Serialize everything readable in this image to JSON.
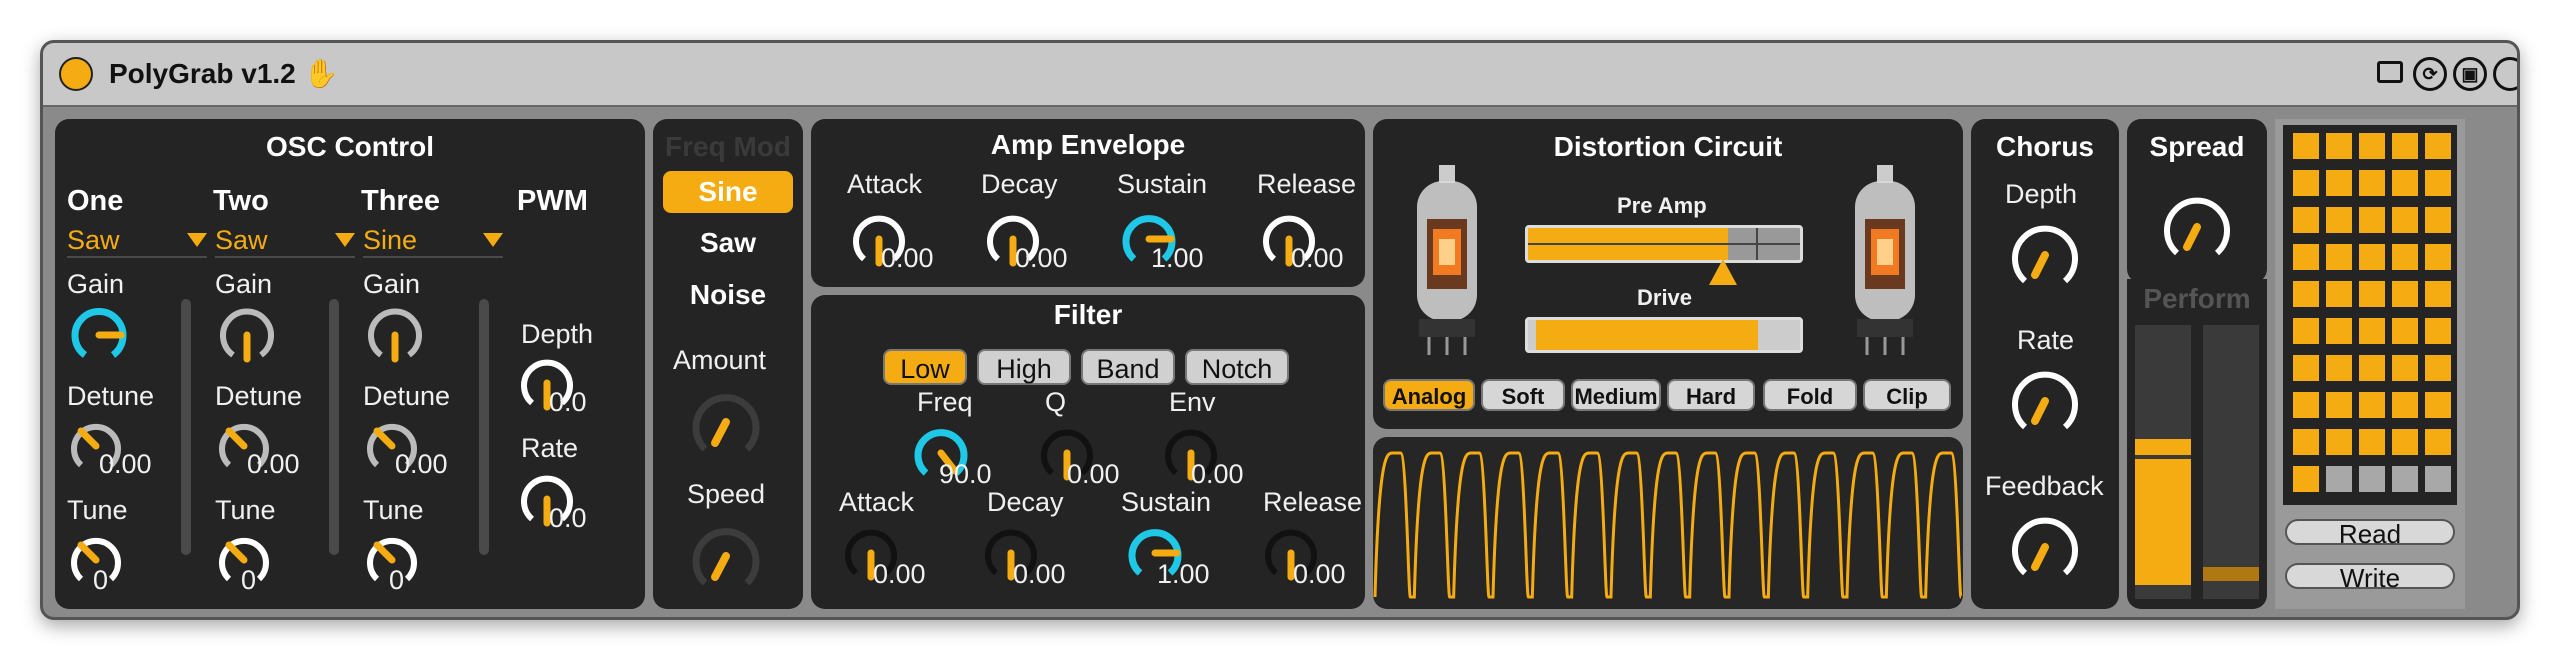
{
  "window": {
    "title": "PolyGrab v1.2"
  },
  "colors": {
    "accent": "#f5ac12",
    "cyan": "#1ec8e6",
    "panel": "#242424"
  },
  "osc": {
    "title": "OSC Control",
    "cols": [
      {
        "name": "One",
        "wave": "Saw",
        "gain": "Gain",
        "detune": "Detune",
        "detune_val": "0.00",
        "tune": "Tune",
        "tune_val": "0"
      },
      {
        "name": "Two",
        "wave": "Saw",
        "gain": "Gain",
        "detune": "Detune",
        "detune_val": "0.00",
        "tune": "Tune",
        "tune_val": "0"
      },
      {
        "name": "Three",
        "wave": "Sine",
        "gain": "Gain",
        "detune": "Detune",
        "detune_val": "0.00",
        "tune": "Tune",
        "tune_val": "0"
      }
    ],
    "pwm": {
      "title": "PWM",
      "depth": "Depth",
      "depth_val": "0.0",
      "rate": "Rate",
      "rate_val": "0.0"
    }
  },
  "freqmod": {
    "title": "Freq Mod",
    "tabs": [
      "Sine",
      "Saw",
      "Noise"
    ],
    "amount": "Amount",
    "speed": "Speed"
  },
  "ampenv": {
    "title": "Amp Envelope",
    "attack": "Attack",
    "attack_val": "0.00",
    "decay": "Decay",
    "decay_val": "0.00",
    "sustain": "Sustain",
    "sustain_val": "1.00",
    "release": "Release",
    "release_val": "0.00"
  },
  "filter": {
    "title": "Filter",
    "types": [
      "Low",
      "High",
      "Band",
      "Notch"
    ],
    "freq": "Freq",
    "freq_val": "90.0",
    "q": "Q",
    "q_val": "0.00",
    "env": "Env",
    "env_val": "0.00",
    "attack": "Attack",
    "attack_val": "0.00",
    "decay": "Decay",
    "decay_val": "0.00",
    "sustain": "Sustain",
    "sustain_val": "1.00",
    "release": "Release",
    "release_val": "0.00"
  },
  "distortion": {
    "title": "Distortion Circuit",
    "preamp": "Pre Amp",
    "drive": "Drive",
    "modes": [
      "Analog",
      "Soft",
      "Medium",
      "Hard",
      "Fold",
      "Clip"
    ]
  },
  "chorus": {
    "title": "Chorus",
    "depth": "Depth",
    "rate": "Rate",
    "feedback": "Feedback"
  },
  "spread": {
    "title": "Spread",
    "perform": "Perform"
  },
  "sequencer": {
    "read": "Read",
    "write": "Write"
  }
}
